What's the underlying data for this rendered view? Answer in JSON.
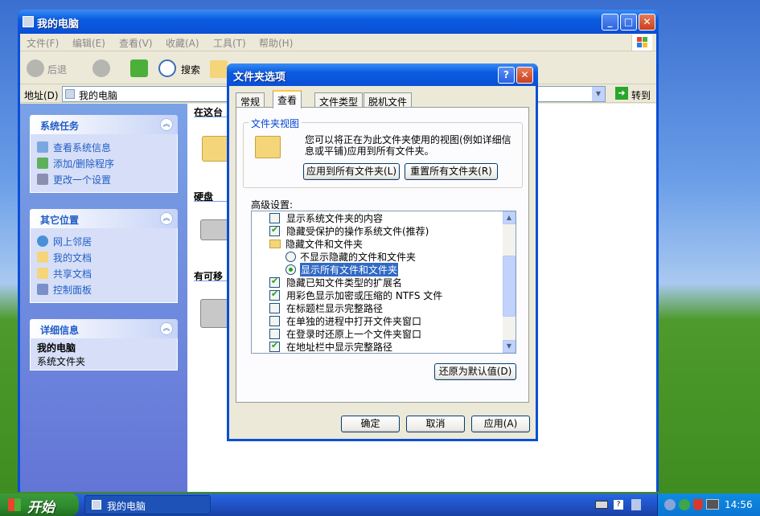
{
  "explorer": {
    "title": "我的电脑",
    "menu": [
      "文件(F)",
      "编辑(E)",
      "查看(V)",
      "收藏(A)",
      "工具(T)",
      "帮助(H)"
    ],
    "toolbar": {
      "back": "后退",
      "search": "搜索"
    },
    "address": {
      "label": "地址(D)",
      "value": "我的电脑",
      "go": "转到"
    },
    "panels": {
      "system_tasks": {
        "title": "系统任务",
        "items": [
          "查看系统信息",
          "添加/删除程序",
          "更改一个设置"
        ]
      },
      "other_places": {
        "title": "其它位置",
        "items": [
          "网上邻居",
          "我的文档",
          "共享文档",
          "控制面板"
        ]
      },
      "details": {
        "title": "详细信息",
        "name": "我的电脑",
        "desc": "系统文件夹"
      }
    },
    "groups": [
      "在这台",
      "硬盘",
      "有可移"
    ]
  },
  "dialog": {
    "title": "文件夹选项",
    "tabs": [
      "常规",
      "查看",
      "文件类型",
      "脱机文件"
    ],
    "active_tab": "查看",
    "folder_views": {
      "legend": "文件夹视图",
      "text": "您可以将正在为此文件夹使用的视图(例如详细信息或平铺)应用到所有文件夹。",
      "apply_all": "应用到所有文件夹(L)",
      "reset_all": "重置所有文件夹(R)"
    },
    "advanced_label": "高级设置:",
    "settings": [
      {
        "kind": "checkbox",
        "checked": false,
        "label": "显示系统文件夹的内容"
      },
      {
        "kind": "checkbox",
        "checked": true,
        "label": "隐藏受保护的操作系统文件(推荐)"
      },
      {
        "kind": "folder",
        "label": "隐藏文件和文件夹"
      },
      {
        "kind": "radio",
        "checked": false,
        "label": "不显示隐藏的文件和文件夹"
      },
      {
        "kind": "radio",
        "checked": true,
        "label": "显示所有文件和文件夹"
      },
      {
        "kind": "checkbox",
        "checked": true,
        "label": "隐藏已知文件类型的扩展名"
      },
      {
        "kind": "checkbox",
        "checked": true,
        "label": "用彩色显示加密或压缩的 NTFS 文件"
      },
      {
        "kind": "checkbox",
        "checked": false,
        "label": "在标题栏显示完整路径"
      },
      {
        "kind": "checkbox",
        "checked": false,
        "label": "在单独的进程中打开文件夹窗口"
      },
      {
        "kind": "checkbox",
        "checked": false,
        "label": "在登录时还原上一个文件夹窗口"
      },
      {
        "kind": "checkbox",
        "checked": true,
        "label": "在地址栏中显示完整路径"
      }
    ],
    "restore_defaults": "还原为默认值(D)",
    "ok": "确定",
    "cancel": "取消",
    "apply": "应用(A)"
  },
  "taskbar": {
    "start": "开始",
    "item": "我的电脑",
    "clock": "14:56"
  }
}
